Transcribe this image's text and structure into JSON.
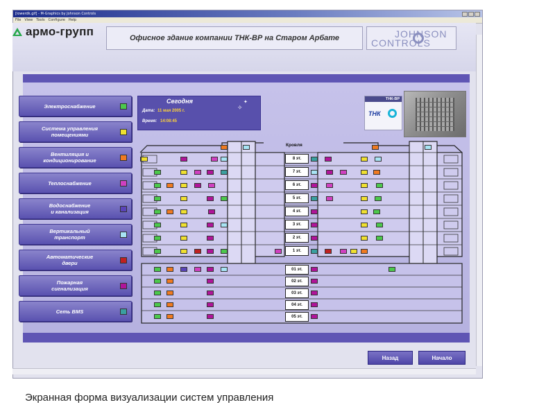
{
  "window": {
    "title": "[lowerdk.gif] - M-Graphics by Johnson Controls",
    "menu": [
      "File",
      "View",
      "Tools",
      "Configure",
      "Help"
    ]
  },
  "header": {
    "logo_text": "армо-групп",
    "building_title": "Офисное здание компании ТНК-ВР на Старом Арбате",
    "partner_line1": "JOHNSON",
    "partner_line2": "CONTROLS"
  },
  "systems": [
    {
      "label": "Электроснабжение",
      "color": "#4cc84c"
    },
    {
      "label": "Система управления\nпомещениями",
      "color": "#f0e030"
    },
    {
      "label": "Вентиляция и\nкондиционирование",
      "color": "#f07a20"
    },
    {
      "label": "Теплоснабжение",
      "color": "#d040c0"
    },
    {
      "label": "Водоснабжение\nи канализация",
      "color": "#5a44b8"
    },
    {
      "label": "Вертикальный\nтранспорт",
      "color": "#a8e4f4"
    },
    {
      "label": "Автоматические\nдвери",
      "color": "#c02020"
    },
    {
      "label": "Пожарная\nсигнализация",
      "color": "#b0149a"
    },
    {
      "label": "Сеть BMS",
      "color": "#3aa0a0"
    }
  ],
  "today": {
    "heading": "Сегодня",
    "date_label": "Дата:",
    "date_value": "11 мая 2005 г.",
    "time_label": "Время:",
    "time_value": "14:08:45"
  },
  "brand": {
    "badge": "ТНК-ВР",
    "logo": "ТНК"
  },
  "building": {
    "roof_label": "Кровля",
    "floors": [
      "8 эт.",
      "7 эт.",
      "6 эт.",
      "5 эт.",
      "4 эт.",
      "3 эт.",
      "2 эт.",
      "1 эт.",
      "01 эт.",
      "02 эт.",
      "03 эт.",
      "04 эт.",
      "05 эт."
    ]
  },
  "nav": {
    "back": "Назад",
    "home": "Начало"
  },
  "caption": "Экранная форма визуализации систем управления"
}
